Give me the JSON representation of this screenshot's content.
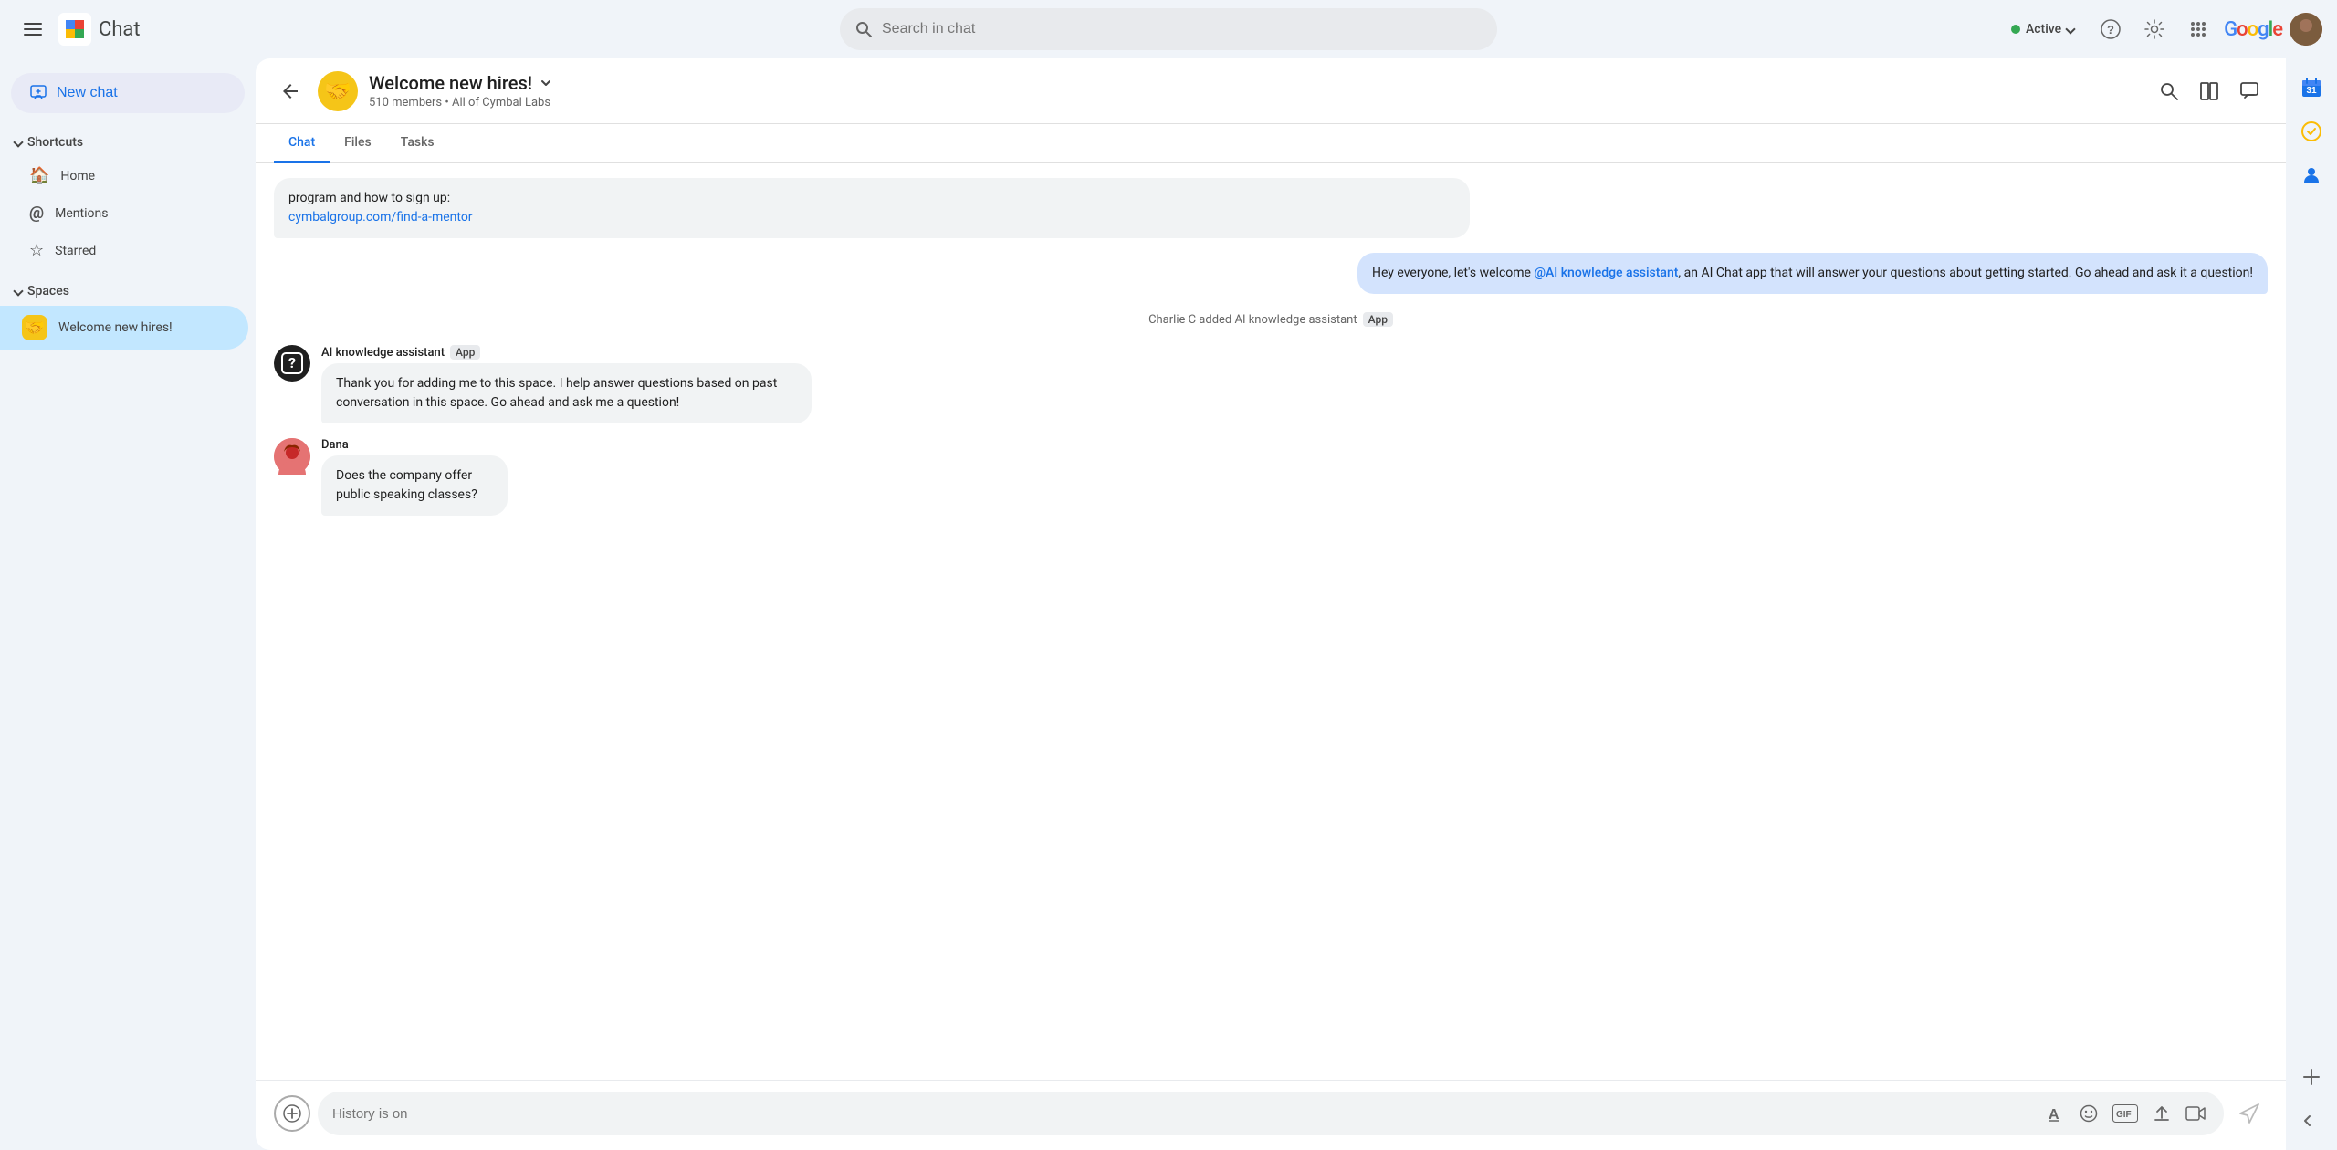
{
  "app": {
    "title": "Chat",
    "logo_alt": "Google Chat logo"
  },
  "topnav": {
    "search_placeholder": "Search in chat",
    "status_label": "Active",
    "status_color": "#34a853",
    "help_icon": "?",
    "settings_icon": "⚙",
    "grid_icon": "⋮⋮⋮",
    "google_logo": "Google",
    "avatar_text": "U"
  },
  "sidebar": {
    "new_chat_label": "New chat",
    "shortcuts_label": "Shortcuts",
    "shortcuts_expanded": true,
    "items": [
      {
        "id": "home",
        "label": "Home",
        "icon": "🏠"
      },
      {
        "id": "mentions",
        "label": "Mentions",
        "icon": "@"
      },
      {
        "id": "starred",
        "label": "Starred",
        "icon": "☆"
      }
    ],
    "spaces_label": "Spaces",
    "spaces_expanded": true,
    "spaces": [
      {
        "id": "welcome-new-hires",
        "label": "Welcome new hires!",
        "emoji": "🤝",
        "active": true
      }
    ]
  },
  "channel": {
    "back_label": "back",
    "title": "Welcome new hires!",
    "emoji": "🤝",
    "members_count": "510 members",
    "scope": "All of Cymbal Labs",
    "tabs": [
      {
        "id": "chat",
        "label": "Chat",
        "active": true
      },
      {
        "id": "files",
        "label": "Files",
        "active": false
      },
      {
        "id": "tasks",
        "label": "Tasks",
        "active": false
      }
    ],
    "actions": {
      "search": "🔍",
      "layout": "⊡",
      "threads": "💬"
    }
  },
  "messages": [
    {
      "id": "msg1",
      "type": "partial",
      "text": "program and how to sign up:",
      "link_text": "cymbalgroup.com/find-a-mentor",
      "link_url": "cymbalgroup.com/find-a-mentor"
    },
    {
      "id": "msg2",
      "type": "self",
      "text_before": "Hey everyone, let's welcome ",
      "mention": "@AI knowledge assistant",
      "text_after": ", an AI Chat app that will answer your questions about getting started.  Go ahead and ask it a question!"
    },
    {
      "id": "msg3",
      "type": "system",
      "text": "Charlie C added AI knowledge assistant",
      "badge": "App"
    },
    {
      "id": "msg4",
      "type": "ai",
      "sender": "AI knowledge assistant",
      "sender_badge": "App",
      "text": "Thank you for adding me to this space. I help answer questions based on past conversation in this space. Go ahead and ask me a question!",
      "avatar_icon": "❓"
    },
    {
      "id": "msg5",
      "type": "user",
      "sender": "Dana",
      "text": "Does the company offer public speaking classes?",
      "avatar_emoji": "👩‍🦰"
    }
  ],
  "input": {
    "placeholder": "History is on",
    "add_icon": "+",
    "text_format_icon": "A",
    "emoji_icon": "🙂",
    "gif_icon": "GIF",
    "upload_icon": "⬆",
    "video_icon": "⊞",
    "send_icon": "▷"
  },
  "right_rail": {
    "calendar_icon": "calendar",
    "tasks_icon": "tasks",
    "contacts_icon": "contacts",
    "add_icon": "+",
    "expand_icon": "›"
  }
}
